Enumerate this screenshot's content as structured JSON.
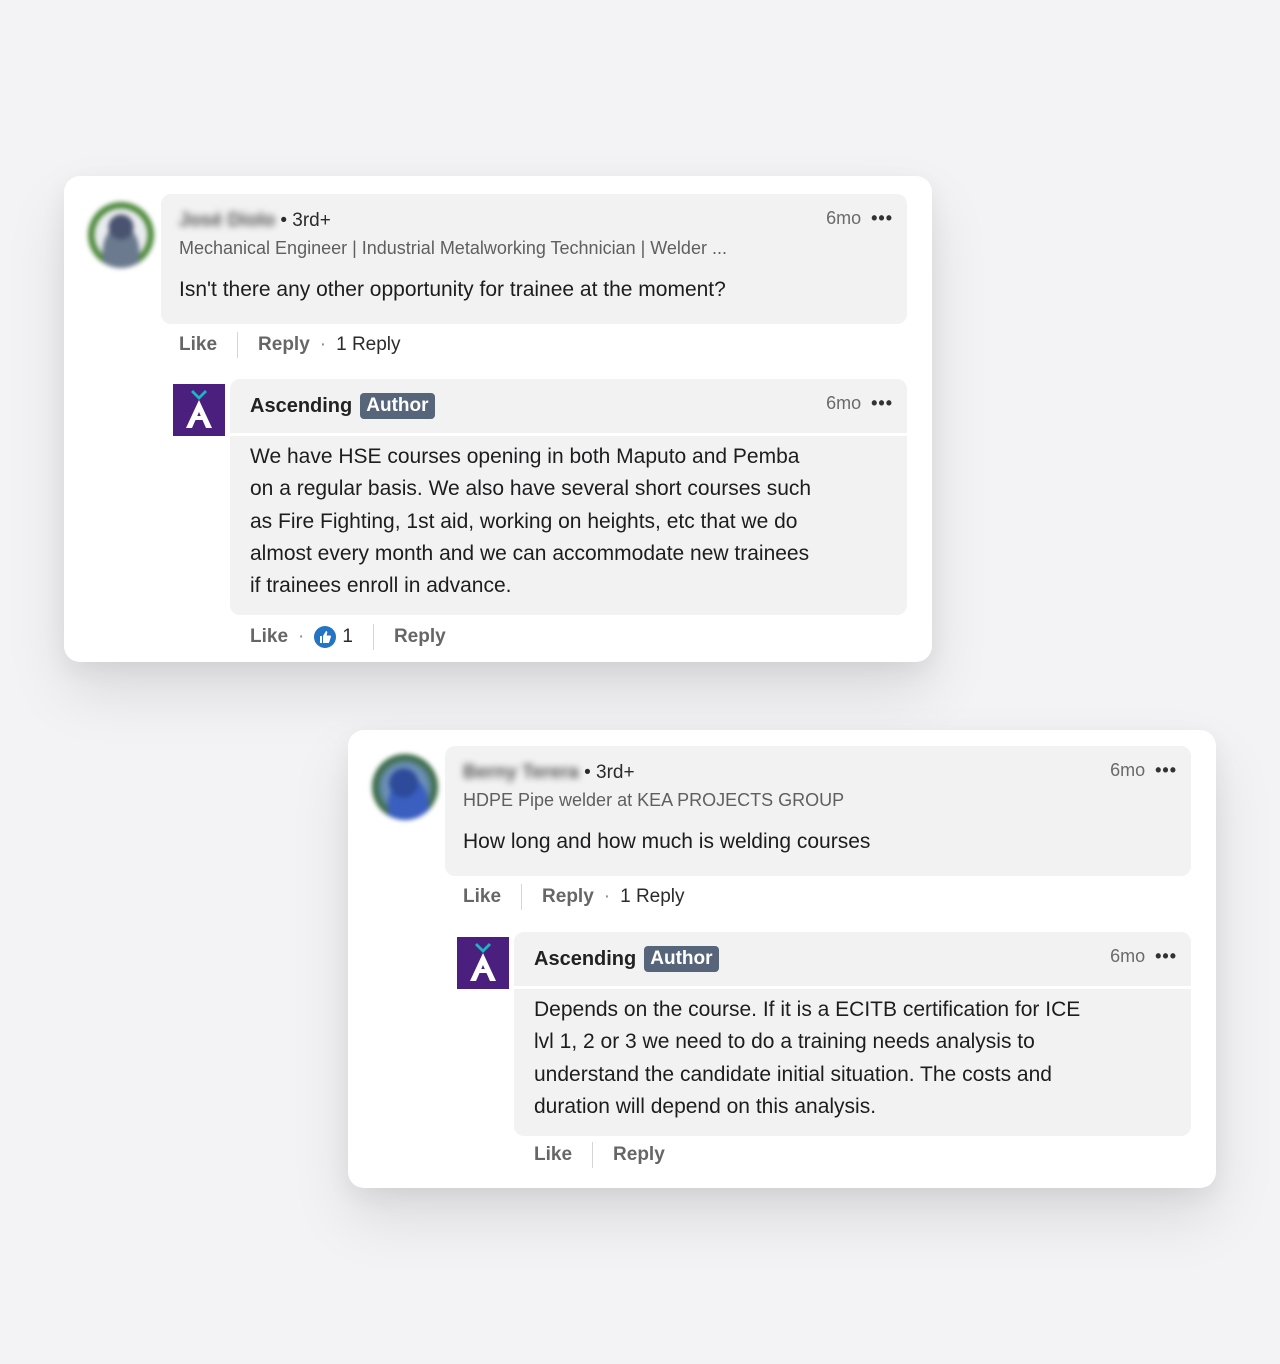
{
  "comments": [
    {
      "author_name": "José Diolo",
      "degree": "• 3rd+",
      "headline": "Mechanical Engineer | Industrial Metalworking Technician | Welder ...",
      "time": "6mo",
      "more": "•••",
      "text": "Isn't there any other opportunity for trainee at the moment?",
      "like": "Like",
      "reply": "Reply",
      "dot": "·",
      "replies_count": "1 Reply",
      "reply_item": {
        "name": "Ascending",
        "badge": "Author",
        "time": "6mo",
        "more": "•••",
        "lines": [
          "We have HSE courses opening in both Maputo and Pemba",
          "on a regular basis. We also have several short courses such",
          "as Fire Fighting, 1st aid, working on heights, etc that we do",
          "almost every month and we can accommodate new trainees",
          "if trainees enroll in advance."
        ],
        "like": "Like",
        "dot": "·",
        "reactions": "1",
        "reply": "Reply"
      }
    },
    {
      "author_name": "Berny Terera",
      "degree": "• 3rd+",
      "headline": "HDPE Pipe welder at KEA PROJECTS GROUP",
      "time": "6mo",
      "more": "•••",
      "text": "How long and how much is welding courses",
      "like": "Like",
      "reply": "Reply",
      "dot": "·",
      "replies_count": "1 Reply",
      "reply_item": {
        "name": "Ascending",
        "badge": "Author",
        "time": "6mo",
        "more": "•••",
        "lines": [
          "Depends on the course. If it is a ECITB certification for ICE",
          "lvl 1, 2 or 3 we need to do a training needs analysis to",
          "understand the candidate initial situation. The costs and",
          "duration will depend on this analysis."
        ],
        "like": "Like",
        "reply": "Reply"
      }
    }
  ],
  "colors": {
    "brand_purple": "#4b1f7e",
    "brand_teal": "#19b6c4",
    "badge": "#56657a",
    "reaction_blue": "#2473c4"
  }
}
